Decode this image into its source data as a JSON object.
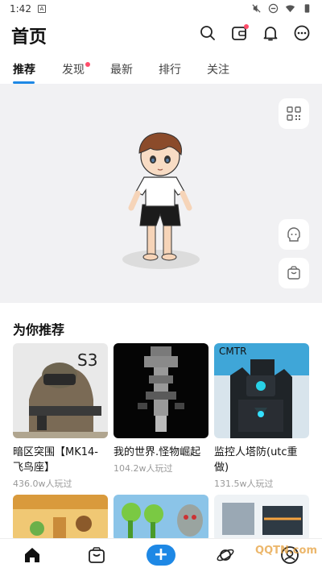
{
  "status_bar": {
    "time": "1:42",
    "app_badge": "A"
  },
  "header": {
    "title": "首页"
  },
  "tabs": [
    "推荐",
    "发现",
    "最新",
    "排行",
    "关注"
  ],
  "section": {
    "title": "为你推荐"
  },
  "cards": [
    {
      "title": "暗区突围【MK14-飞鸟座】",
      "meta": "436.0w人玩过",
      "thumb_text": "S3"
    },
    {
      "title": "我的世界.怪物崛起",
      "meta": "104.2w人玩过",
      "thumb_text": ""
    },
    {
      "title": "监控人塔防(utc重做)",
      "meta": "131.5w人玩过",
      "thumb_text": "CMTR"
    }
  ],
  "bottom_nav": {
    "plus_label": "+"
  },
  "watermark": "QQTN.com",
  "colors": {
    "accent": "#1e88e5",
    "notify_dot": "#ff4d6a",
    "stage_bg": "#f1f1f3"
  }
}
